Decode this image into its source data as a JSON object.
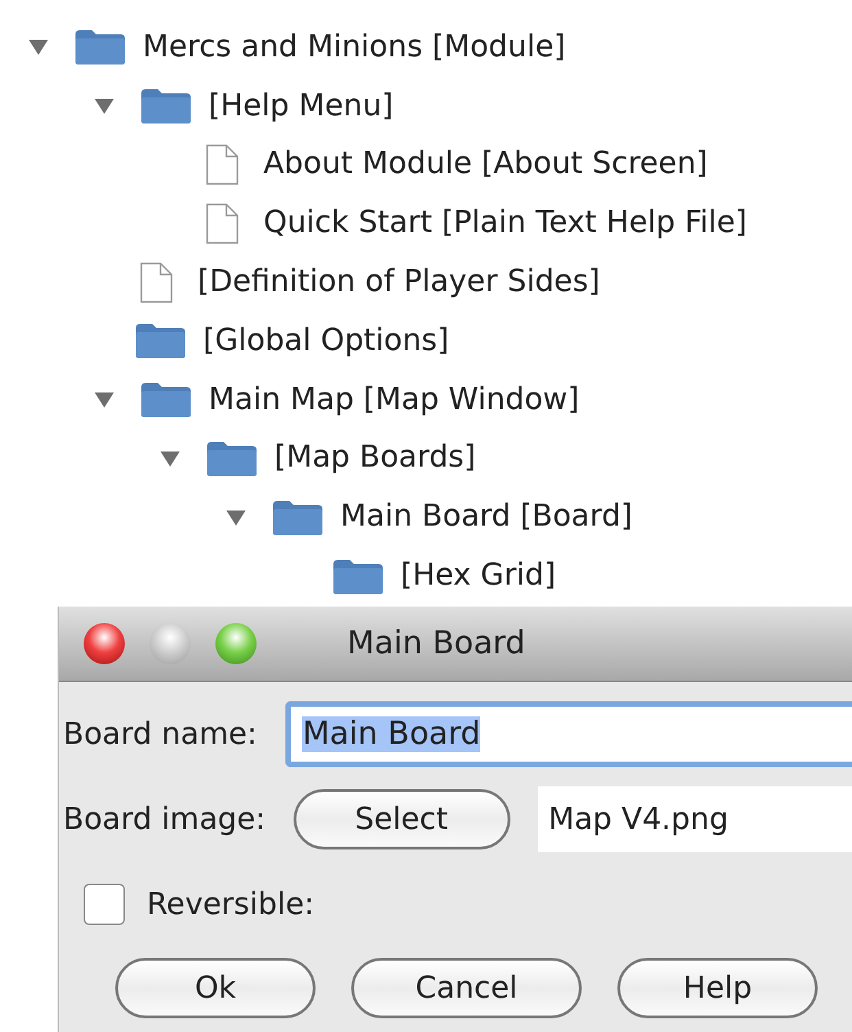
{
  "tree": [
    {
      "kind": "folder",
      "label": "Mercs and Minions [Module]",
      "expanded": true,
      "children": [
        {
          "kind": "folder",
          "label": "[Help Menu]",
          "expanded": true,
          "children": [
            {
              "kind": "file",
              "label": "About Module [About Screen]"
            },
            {
              "kind": "file",
              "label": "Quick Start [Plain Text Help File]"
            }
          ]
        },
        {
          "kind": "file",
          "label": "[Definition of Player Sides]"
        },
        {
          "kind": "folder",
          "label": "[Global Options]"
        },
        {
          "kind": "folder",
          "label": "Main Map [Map Window]",
          "expanded": true,
          "children": [
            {
              "kind": "folder",
              "label": "[Map Boards]",
              "expanded": true,
              "children": [
                {
                  "kind": "folder",
                  "label": "Main Board [Board]",
                  "expanded": true,
                  "children": [
                    {
                      "kind": "folder",
                      "label": "[Hex Grid]"
                    }
                  ]
                }
              ]
            }
          ]
        }
      ]
    }
  ],
  "dialog": {
    "title": "Main Board",
    "name_label": "Board name:",
    "name_value": "Main Board",
    "name_text_selected": true,
    "image_label": "Board image:",
    "select_button": "Select",
    "image_value": "Map V4.png",
    "reversible": {
      "label": "Reversible:",
      "checked": false
    },
    "buttons": [
      "Ok",
      "Cancel",
      "Help"
    ]
  }
}
